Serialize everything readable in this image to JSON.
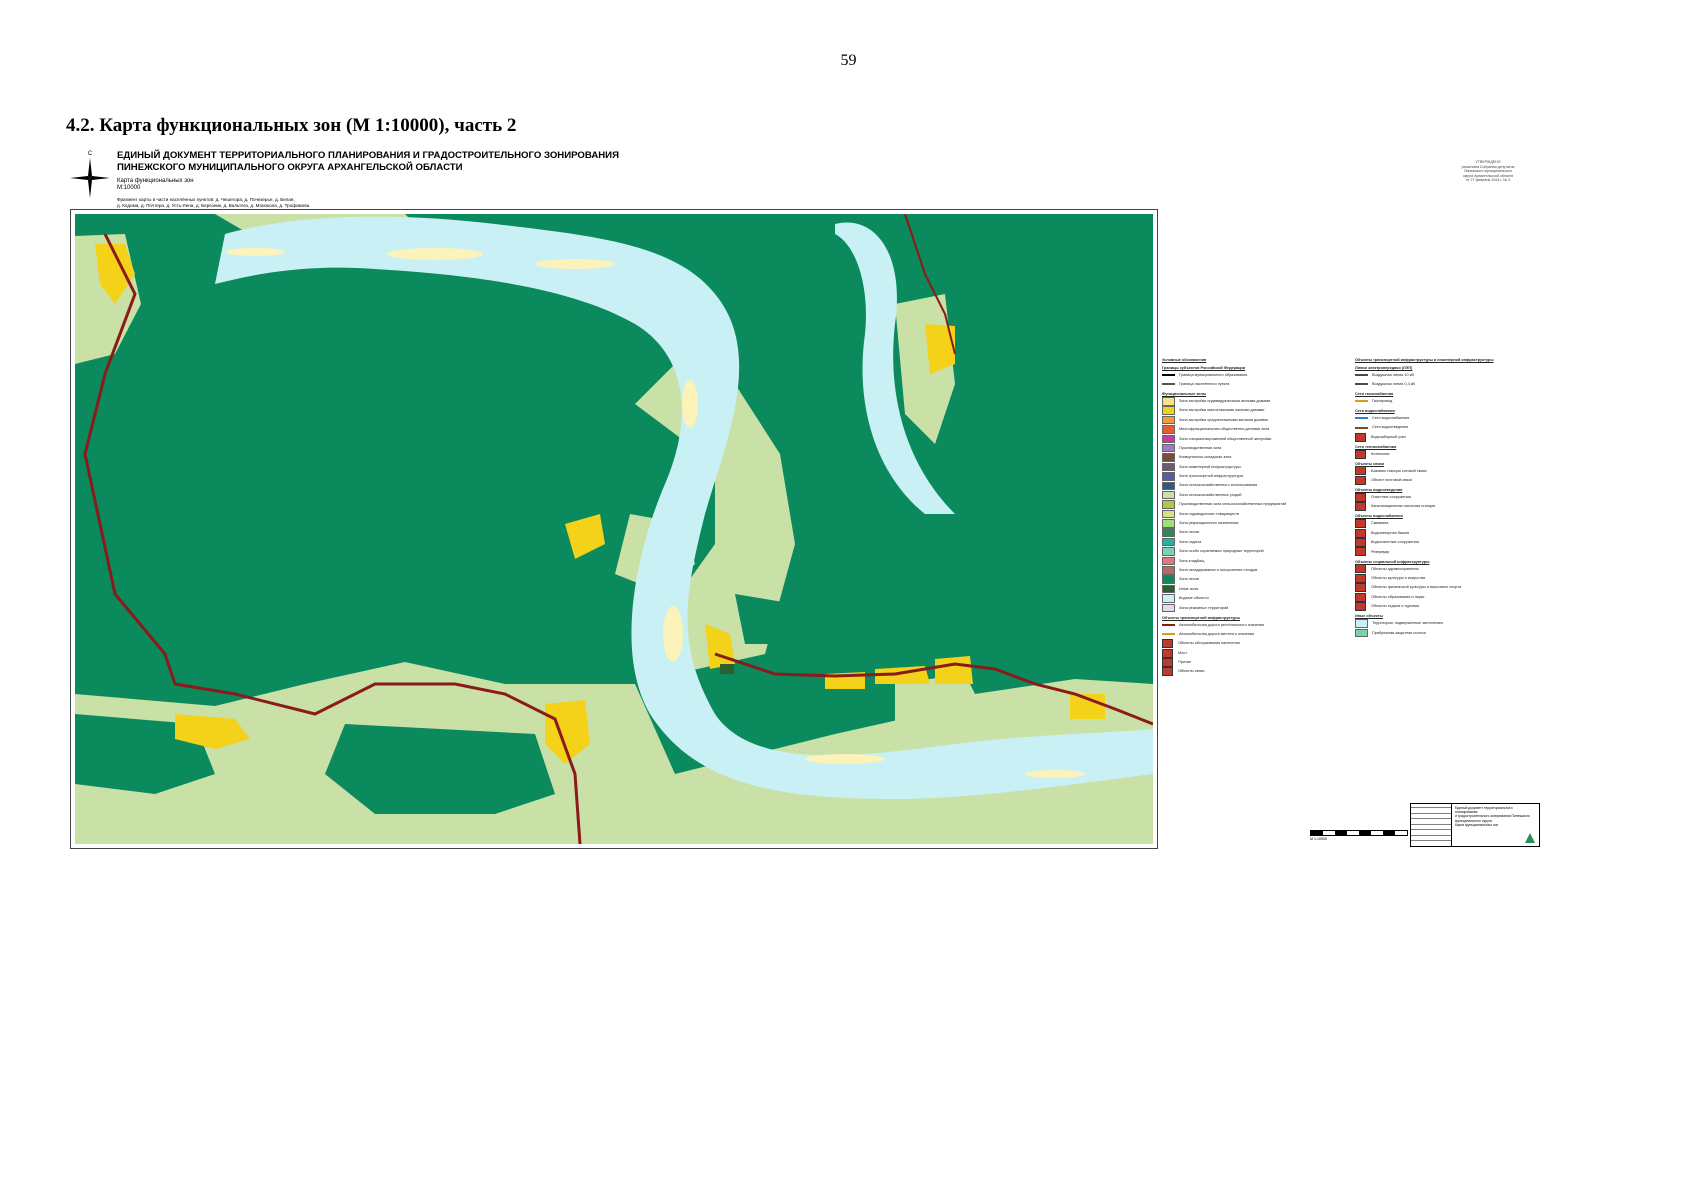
{
  "page": {
    "number": "59",
    "section_title": "4.2. Карта функциональных зон (М 1:10000), часть 2"
  },
  "compass": {
    "north_label": "С"
  },
  "header": {
    "line1": "ЕДИНЫЙ ДОКУМЕНТ ТЕРРИТОРИАЛЬНОГО ПЛАНИРОВАНИЯ И ГРАДОСТРОИТЕЛЬНОГО ЗОНИРОВАНИЯ",
    "line2": "ПИНЕЖСКОГО МУНИЦИПАЛЬНОГО ОКРУГА  АРХАНГЕЛЬСКОЙ ОБЛАСТИ",
    "map_name": "Карта функциональных зон",
    "scale": "М:10000",
    "fragments_line1": "Фрагмент карты в части населённых пунктов: д. Чешегора, д. Почезерье, д. Белая,",
    "fragments_line2": "д. Кодома, д. Почтера, д. Усть-Лена, д. Березник, д. Вальтега, д. Монокола, д. Трофимова"
  },
  "approval": [
    "УТВЕРЖДЕНО",
    "решением Собрания депутатов",
    "Пинежского муниципального",
    "округа Архангельской области",
    "от 27 февраля 2024 г. № 3"
  ],
  "colors": {
    "forest": "#0b8a5e",
    "agricultural": "#c9e0a6",
    "water": "#c9f1f5",
    "sandbar": "#fbf3b9",
    "residential": "#f4d21a",
    "road": "#8b1a1a",
    "recreation": "#2e5f2f"
  },
  "map": {
    "north_arrow": "compass-rose",
    "scale_text": "М 1:10000"
  },
  "legend_left": {
    "title": "Условные обозначения",
    "items": [
      {
        "type": "section",
        "label": "Границы субъектов Российской Федерации"
      },
      {
        "type": "line",
        "color": "#000000",
        "label": "Граница муниципального образования"
      },
      {
        "type": "line",
        "color": "#555555",
        "label": "Граница населённого пункта"
      },
      {
        "type": "section",
        "label": "Функциональные зоны"
      },
      {
        "type": "swatch",
        "color": "#f6e48a",
        "label": "Зона застройки индивидуальными жилыми домами"
      },
      {
        "type": "swatch",
        "color": "#f4d21a",
        "label": "Зона застройки малоэтажными жилыми домами"
      },
      {
        "type": "swatch",
        "color": "#f19b3a",
        "label": "Зона застройки среднеэтажными жилыми домами"
      },
      {
        "type": "swatch",
        "color": "#e75d2d",
        "label": "Многофункциональная общественно-деловая зона"
      },
      {
        "type": "swatch",
        "color": "#c83aa0",
        "label": "Зона специализированной общественной застройки"
      },
      {
        "type": "swatch",
        "color": "#a17bc4",
        "label": "Производственная зона"
      },
      {
        "type": "swatch",
        "color": "#7d4b3b",
        "label": "Коммунально-складская зона"
      },
      {
        "type": "swatch",
        "color": "#6a5c73",
        "label": "Зона инженерной инфраструктуры"
      },
      {
        "type": "swatch",
        "color": "#5b5b9f",
        "label": "Зона транспортной инфраструктуры"
      },
      {
        "type": "swatch",
        "color": "#2f5c7c",
        "label": "Зона сельскохозяйственного использования"
      },
      {
        "type": "swatch",
        "color": "#c9e0a6",
        "label": "Зона сельскохозяйственных угодий"
      },
      {
        "type": "swatch",
        "color": "#b6c24c",
        "label": "Производственная зона сельскохозяйственных предприятий"
      },
      {
        "type": "swatch",
        "color": "#d6e27a",
        "label": "Зона садоводческих товариществ"
      },
      {
        "type": "swatch",
        "color": "#9fe07a",
        "label": "Зона рекреационного назначения"
      },
      {
        "type": "swatch",
        "color": "#2e8b57",
        "label": "Зона лесов"
      },
      {
        "type": "swatch",
        "color": "#1fb6a0",
        "label": "Зона отдыха"
      },
      {
        "type": "swatch",
        "color": "#79d2b0",
        "label": "Зона особо охраняемых природных территорий"
      },
      {
        "type": "swatch",
        "color": "#e07a7a",
        "label": "Зона кладбищ"
      },
      {
        "type": "swatch",
        "color": "#b56a6a",
        "label": "Зона складирования и захоронения отходов"
      },
      {
        "type": "swatch",
        "color": "#0b8a5e",
        "label": "Зона лесов"
      },
      {
        "type": "swatch",
        "color": "#2e5f2f",
        "label": "Иные зоны"
      },
      {
        "type": "swatch",
        "color": "#c9f1f5",
        "label": "Водные объекты"
      },
      {
        "type": "swatch",
        "color": "#e8d8f0",
        "label": "Зона режимных территорий"
      },
      {
        "type": "section",
        "label": "Объекты транспортной инфраструктуры"
      },
      {
        "type": "line",
        "color": "#8b1a1a",
        "label": "Автомобильная дорога регионального значения"
      },
      {
        "type": "line",
        "color": "#d4a017",
        "label": "Автомобильная дорога местного значения"
      },
      {
        "type": "symbol",
        "label": "Объекты обслуживания населения"
      },
      {
        "type": "symbol",
        "label": "Мост"
      },
      {
        "type": "symbol",
        "label": "Причал"
      },
      {
        "type": "symbol",
        "label": "Объекты связи"
      }
    ]
  },
  "legend_right": {
    "title": "Объекты транспортной инфраструктуры и инженерной инфраструктуры",
    "items": [
      {
        "type": "section",
        "label": "Линии электропередачи (ЛЭП)"
      },
      {
        "type": "line",
        "color": "#4a4a4a",
        "label": "Воздушная линия 10 кВ"
      },
      {
        "type": "line",
        "color": "#4a4a4a",
        "label": "Воздушная линия 0,4 кВ"
      },
      {
        "type": "section",
        "label": "Сети газоснабжения"
      },
      {
        "type": "line",
        "color": "#d4a017",
        "label": "Газопровод"
      },
      {
        "type": "section",
        "label": "Сети водоснабжения"
      },
      {
        "type": "line",
        "color": "#2f7fd1",
        "label": "Сети водоснабжения"
      },
      {
        "type": "line",
        "color": "#7a4a2a",
        "label": "Сети водоотведения"
      },
      {
        "type": "symbol",
        "label": "Водозаборный узел"
      },
      {
        "type": "section",
        "label": "Сети теплоснабжения"
      },
      {
        "type": "symbol",
        "label": "Котельная"
      },
      {
        "type": "section",
        "label": "Объекты связи"
      },
      {
        "type": "symbol",
        "label": "Базовая станция сотовой связи"
      },
      {
        "type": "symbol",
        "label": "Объект почтовой связи"
      },
      {
        "type": "section",
        "label": "Объекты водоотведения"
      },
      {
        "type": "symbol",
        "label": "Очистные сооружения"
      },
      {
        "type": "symbol",
        "label": "Канализационная насосная станция"
      },
      {
        "type": "section",
        "label": "Объекты водоснабжения"
      },
      {
        "type": "symbol",
        "label": "Скважина"
      },
      {
        "type": "symbol",
        "label": "Водонапорная башня"
      },
      {
        "type": "symbol",
        "label": "Водоочистные сооружения"
      },
      {
        "type": "symbol",
        "label": "Резервуар"
      },
      {
        "type": "section",
        "label": "Объекты социальной инфраструктуры"
      },
      {
        "type": "symbol",
        "label": "Объекты здравоохранения"
      },
      {
        "type": "symbol",
        "label": "Объекты культуры и искусства"
      },
      {
        "type": "symbol",
        "label": "Объекты физической культуры и массового спорта"
      },
      {
        "type": "symbol",
        "label": "Объекты образования и науки"
      },
      {
        "type": "symbol",
        "label": "Объекты отдыха и туризма"
      },
      {
        "type": "section",
        "label": "Иные объекты"
      },
      {
        "type": "swatch",
        "color": "#c9f1f5",
        "label": "Территории, подверженные затоплению"
      },
      {
        "type": "swatch",
        "color": "#79d2b0",
        "label": "Прибрежная защитная полоса"
      }
    ]
  },
  "title_block": {
    "line1": "Единый документ территориального планирования",
    "line2": "и градостроительного зонирования Пинежского",
    "line3": "муниципального округа",
    "line4": "Карта функциональных зон"
  }
}
